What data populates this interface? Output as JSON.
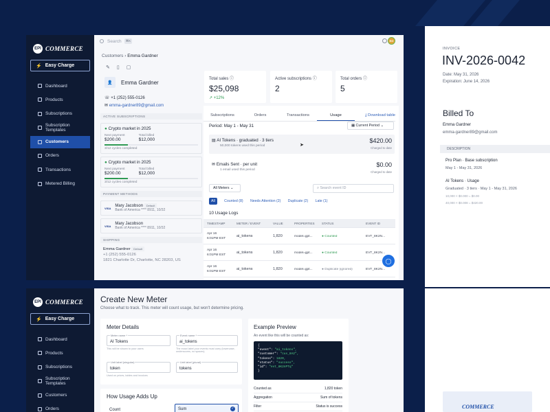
{
  "brand": {
    "logo_badge": "EPI",
    "logo_text": "COMMERCE"
  },
  "sidebar": {
    "easy_charge": "Easy Charge",
    "items": [
      {
        "label": "Dashboard",
        "active": false
      },
      {
        "label": "Products",
        "active": false
      },
      {
        "label": "Subscriptions",
        "active": false
      },
      {
        "label": "Subscription Templates",
        "active": false
      },
      {
        "label": "Customers",
        "active": true
      },
      {
        "label": "Orders",
        "active": false
      },
      {
        "label": "Transactions",
        "active": false
      },
      {
        "label": "Metered Billing",
        "active": false
      }
    ]
  },
  "topbar": {
    "search_placeholder": "Search",
    "shortcut": "⌘K",
    "avatar_initials": "EG"
  },
  "breadcrumb": {
    "parent": "Customers",
    "current": "Emma Gardner"
  },
  "customer": {
    "name": "Emma Gardner",
    "phone": "+1 (252) 555-0126",
    "email": "emma-gardner89@gmail.com"
  },
  "active_subscriptions": {
    "heading": "ACTIVE SUBSCRIPTIONS",
    "items": [
      {
        "title": "Crypto market in 2025",
        "next_payment_label": "Next payment",
        "next_payment": "$200.00",
        "total_billed_label": "Total billed",
        "total_billed": "$12,000",
        "cycles": "3/12 cycles completed",
        "progress": 0.25
      },
      {
        "title": "Crypto market in 2025",
        "next_payment_label": "Next payment",
        "next_payment": "$200.00",
        "total_billed_label": "Total billed",
        "total_billed": "$12,000",
        "cycles": "3/12 cycles completed",
        "progress": 0.25
      }
    ]
  },
  "payment_methods": {
    "heading": "PAYMENT METHODS",
    "items": [
      {
        "brand": "VISA",
        "name": "Mary Jacobson",
        "badge": "Default",
        "detail": "Bank of America **** 8911, 10/32"
      },
      {
        "brand": "VISA",
        "name": "Mary Jacobson",
        "badge": "",
        "detail": "Bank of America **** 8911, 10/32"
      }
    ]
  },
  "shipping": {
    "heading": "SHIPPING",
    "name": "Emma Gardner",
    "badge": "Default",
    "phone": "+1 (252) 555-0126",
    "address": "1821 Charlotte Dr, Charlotte, NC 28203, US"
  },
  "stats": [
    {
      "label": "Total sales",
      "value": "$25,098",
      "delta": "↗ +12%"
    },
    {
      "label": "Active subscriptions",
      "value": "2",
      "delta": ""
    },
    {
      "label": "Total orders",
      "value": "5",
      "delta": ""
    }
  ],
  "tabs": [
    "Subscriptions",
    "Orders",
    "Transactions",
    "Usage"
  ],
  "download_label": "Download table",
  "period": {
    "label": "Period: May 1 - May 31",
    "select": "Current Period"
  },
  "usage_summary": [
    {
      "title": "AI Tokens · graduated · 3 tiers",
      "sub": "50,000 tokens used this period",
      "amount": "$420.00",
      "amount_sub": "Charged to date"
    },
    {
      "title": "Emails Sent · per unit",
      "sub": "1 email used this period",
      "amount": "$0.00",
      "amount_sub": "Charged to date"
    }
  ],
  "meter_filter": "All Meters",
  "event_search_placeholder": "Search event ID",
  "status_filters": [
    "All",
    "Counted (8)",
    "Needs Attention (2)",
    "Duplicate (2)",
    "Late (1)"
  ],
  "usage_logs": {
    "title": "10 Usage Logs",
    "columns": [
      "TIMESTAMP",
      "METER / EVENT",
      "VALUE",
      "PROPERTIES",
      "STATUS",
      "EVENT ID"
    ],
    "rows": [
      {
        "date": "Apr 16",
        "time": "6:01PM EST",
        "meter": "ai_tokens",
        "value": "1,820",
        "props": "model=gpt...",
        "status": "Counted",
        "event_id": "EVT_8K2N..."
      },
      {
        "date": "Apr 16",
        "time": "6:01PM EST",
        "meter": "ai_tokens",
        "value": "1,820",
        "props": "model=gpt...",
        "status": "Counted",
        "event_id": "EVT_8K2N..."
      },
      {
        "date": "Apr 16",
        "time": "6:01PM EST",
        "meter": "ai_tokens",
        "value": "1,820",
        "props": "model=gpt...",
        "status": "Duplicate (ignored)",
        "event_id": "EVT_8K2N..."
      }
    ]
  },
  "invoice": {
    "label": "INVOICE",
    "number": "INV-2026-0042",
    "date": "Date: May 31, 2026",
    "expiration": "Expiration: June 14, 2026",
    "billed_to_label": "Billed To",
    "billed_name": "Emma Gardner",
    "billed_email": "emma-gardner89@gmail.com",
    "description_label": "DESCRIPTION",
    "lines": [
      {
        "title": "Pro Plan · Base subscription",
        "sub": "May 1 - May 31, 2026",
        "extra": []
      },
      {
        "title": "AI Tokens · Usage",
        "sub": "Graduated · 3 tiers · May 1 - May 31, 2026",
        "extra": [
          "10,000 × $0.000 = $0.00",
          "40,000 × $0.008 = $420.00"
        ]
      }
    ],
    "footer_logo": "COMMERCE"
  },
  "create_meter": {
    "title": "Create New Meter",
    "subtitle": "Choose what to track. This meter will count usage, but won't determine pricing.",
    "details_heading": "Meter Details",
    "meter_name_label": "Meter name *",
    "meter_name": "AI Tokens",
    "meter_name_hint": "This will be shown to your users",
    "event_name_label": "Event name *",
    "event_name": "ai_tokens",
    "event_name_hint": "The exact label your events must carry (lowercase, underscores, no spaces)",
    "unit_singular_label": "Unit label (singular)",
    "unit_singular": "token",
    "unit_plural_label": "Unit label (plural)",
    "unit_plural": "tokens",
    "unit_hint": "Used on prices, tables and invoices",
    "adds_up_heading": "How Usage Adds Up",
    "count_label": "Count",
    "sum_label": "Sum",
    "preview_heading": "Example Preview",
    "preview_sub": "An event like this will be counted as:",
    "code_lines": [
      {
        "k": "{",
        "v": ""
      },
      {
        "k": "  \"event\": ",
        "v": "\"ai_tokens\","
      },
      {
        "k": "  \"customer\": ",
        "v": "\"cus_8A2\","
      },
      {
        "k": "  \"tokens\": ",
        "v": "1820,"
      },
      {
        "k": "  \"status\": ",
        "v": "\"success\","
      },
      {
        "k": "  \"id\": ",
        "v": "\"evt_8K2nPTq\""
      },
      {
        "k": "}",
        "v": ""
      }
    ],
    "preview_rows": [
      {
        "k": "Counted as",
        "v": "1,820 token"
      },
      {
        "k": "Aggregation",
        "v": "Sum of tokens"
      },
      {
        "k": "Filter",
        "v": "Status is success"
      }
    ]
  }
}
